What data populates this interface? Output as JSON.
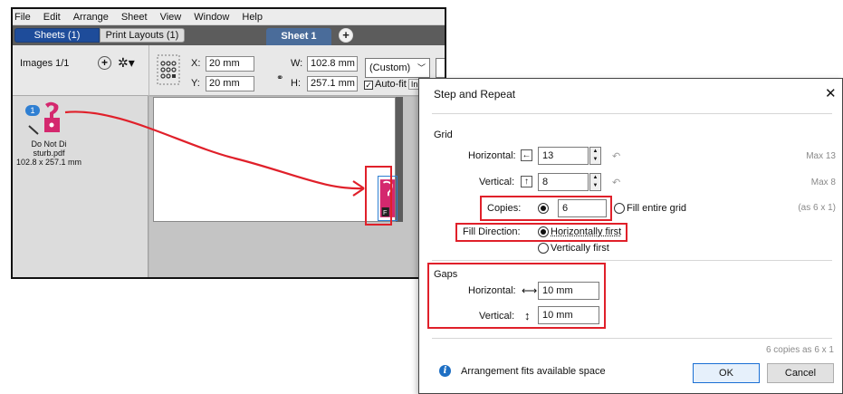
{
  "menu": [
    "File",
    "Edit",
    "Arrange",
    "Sheet",
    "View",
    "Window",
    "Help"
  ],
  "tabs": {
    "sheets": "Sheets (1)",
    "print_layouts": "Print Layouts (1)",
    "sheet1": "Sheet 1"
  },
  "images_panel": {
    "label": "Images 1/1",
    "badge": "1",
    "name_line1": "Do Not Di",
    "name_line2": "sturb.pdf",
    "size": "102.8 x 257.1 mm"
  },
  "toolbar": {
    "x_label": "X:",
    "x_value": "20 mm",
    "y_label": "Y:",
    "y_value": "20 mm",
    "w_label": "W:",
    "w_value": "102.8 mm",
    "h_label": "H:",
    "h_value": "257.1 mm",
    "preset": "(Custom)",
    "autofit": "Auto-fit",
    "autofit_overflow": "In"
  },
  "dialog": {
    "title": "Step and Repeat",
    "grid_heading": "Grid",
    "horizontal_label": "Horizontal:",
    "horizontal_value": "13",
    "horizontal_max": "Max 13",
    "vertical_label": "Vertical:",
    "vertical_value": "8",
    "vertical_max": "Max 8",
    "copies_label": "Copies:",
    "copies_value": "6",
    "fill_entire_grid": "Fill entire grid",
    "copies_note": "(as 6 x 1)",
    "fill_direction_label": "Fill Direction:",
    "horizontally_first": "Horizontally first",
    "vertically_first": "Vertically first",
    "gaps_heading": "Gaps",
    "gap_horizontal_label": "Horizontal:",
    "gap_horizontal_value": "10 mm",
    "gap_vertical_label": "Vertical:",
    "gap_vertical_value": "10 mm",
    "summary": "6 copies as 6 x 1",
    "info_text": "Arrangement fits available space",
    "ok": "OK",
    "cancel": "Cancel"
  },
  "colors": {
    "highlight": "#e0202a",
    "accent": "#1e4c9a",
    "info": "#1e6fc4",
    "artwork_pink": "#d4286e"
  }
}
